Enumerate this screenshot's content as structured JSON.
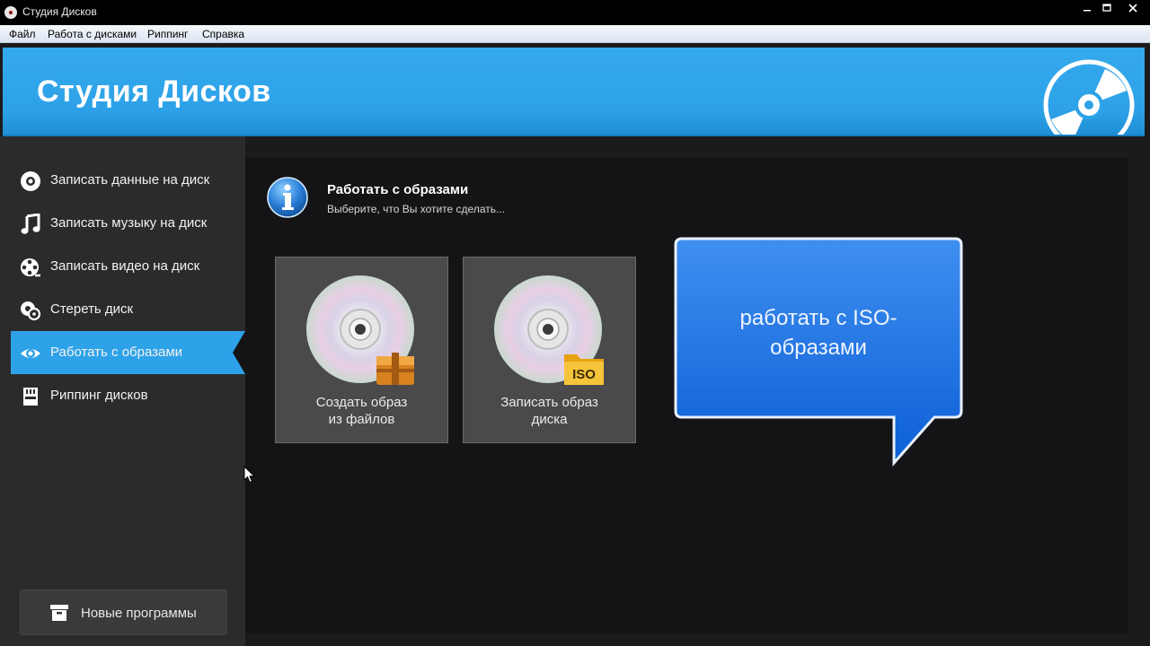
{
  "window": {
    "title": "Студия Дисков",
    "controls": [
      "minimize",
      "maximize",
      "close"
    ]
  },
  "menu": {
    "items": [
      {
        "label": "Файл"
      },
      {
        "label": "Работа с дисками"
      },
      {
        "label": "Риппинг"
      },
      {
        "label": "Справка"
      }
    ]
  },
  "banner": {
    "brand": "Студия Дисков",
    "accent_color": "#2ea2e8"
  },
  "sidebar": {
    "items": [
      {
        "label": "Записать данные на диск",
        "icon": "disc-icon"
      },
      {
        "label": "Записать музыку на диск",
        "icon": "music-note-icon"
      },
      {
        "label": "Записать видео на диск",
        "icon": "film-reel-icon"
      },
      {
        "label": "Стереть диск",
        "icon": "erase-disc-icon"
      },
      {
        "label": "Работать с образами",
        "icon": "eye-icon",
        "active": true
      },
      {
        "label": "Риппинг дисков",
        "icon": "sd-card-icon"
      }
    ],
    "new_programs": {
      "label": "Новые программы",
      "icon": "box-icon"
    }
  },
  "main": {
    "title": "Работать с образами",
    "subtitle": "Выберите, что Вы хотите сделать...",
    "tiles": [
      {
        "line1": "Создать образ",
        "line2": "из файлов",
        "badge": "package-icon"
      },
      {
        "line1": "Записать образ",
        "line2": "диска",
        "badge": "iso-folder-icon",
        "badge_text": "ISO"
      }
    ],
    "callout": {
      "line1": "работать с ISO-",
      "line2": "образами"
    }
  }
}
